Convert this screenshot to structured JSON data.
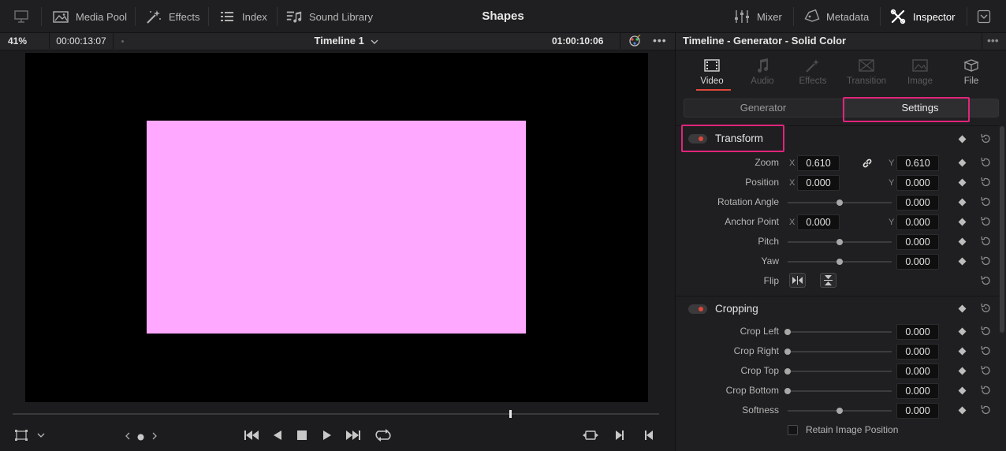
{
  "page_title": "Shapes",
  "toolbar": {
    "left": [
      {
        "label": "",
        "icon": "monitor-icon"
      },
      {
        "label": "Media Pool",
        "icon": "media-pool-icon"
      },
      {
        "label": "Effects",
        "icon": "magic-wand-icon"
      },
      {
        "label": "Index",
        "icon": "list-icon"
      },
      {
        "label": "Sound Library",
        "icon": "music-library-icon"
      }
    ],
    "right": [
      {
        "label": "Mixer",
        "icon": "sliders-icon"
      },
      {
        "label": "Metadata",
        "icon": "tag-icon"
      },
      {
        "label": "Inspector",
        "icon": "inspector-tools-icon",
        "active": true
      }
    ]
  },
  "viewer": {
    "zoom": "41%",
    "timecode_left": "00:00:13:07",
    "timeline_name": "Timeline 1",
    "timecode_right": "01:00:10:06",
    "solid_color": "#ffa8ff",
    "playhead_fraction": 0.77
  },
  "inspector": {
    "title": "Timeline - Generator - Solid Color",
    "tabs": [
      {
        "label": "Video",
        "icon": "film-icon",
        "active": true
      },
      {
        "label": "Audio",
        "icon": "music-note-icon"
      },
      {
        "label": "Effects",
        "icon": "magic-wand-icon"
      },
      {
        "label": "Transition",
        "icon": "transition-icon"
      },
      {
        "label": "Image",
        "icon": "image-icon"
      },
      {
        "label": "File",
        "icon": "file-icon"
      }
    ],
    "subtabs": [
      {
        "label": "Generator",
        "active": false
      },
      {
        "label": "Settings",
        "active": true
      }
    ],
    "transform": {
      "title": "Transform",
      "zoom": {
        "label": "Zoom",
        "x": "0.610",
        "y": "0.610"
      },
      "position": {
        "label": "Position",
        "x": "0.000",
        "y": "0.000"
      },
      "rotation": {
        "label": "Rotation Angle",
        "value": "0.000",
        "slider_level": 0.5
      },
      "anchor": {
        "label": "Anchor Point",
        "x": "0.000",
        "y": "0.000"
      },
      "pitch": {
        "label": "Pitch",
        "value": "0.000",
        "slider_level": 0.5
      },
      "yaw": {
        "label": "Yaw",
        "value": "0.000",
        "slider_level": 0.5
      },
      "flip": {
        "label": "Flip"
      }
    },
    "cropping": {
      "title": "Cropping",
      "crop_left": {
        "label": "Crop Left",
        "value": "0.000",
        "slider_level": 0.0
      },
      "crop_right": {
        "label": "Crop Right",
        "value": "0.000",
        "slider_level": 0.0
      },
      "crop_top": {
        "label": "Crop Top",
        "value": "0.000",
        "slider_level": 0.0
      },
      "crop_bottom": {
        "label": "Crop Bottom",
        "value": "0.000",
        "slider_level": 0.0
      },
      "softness": {
        "label": "Softness",
        "value": "0.000",
        "slider_level": 0.5
      },
      "retain": {
        "label": "Retain Image Position",
        "checked": false
      }
    },
    "axis_x": "X",
    "axis_y": "Y"
  },
  "colors": {
    "accent_red": "#e0483a",
    "highlight_pink": "#e0247a",
    "background": "#1c1c1e"
  }
}
